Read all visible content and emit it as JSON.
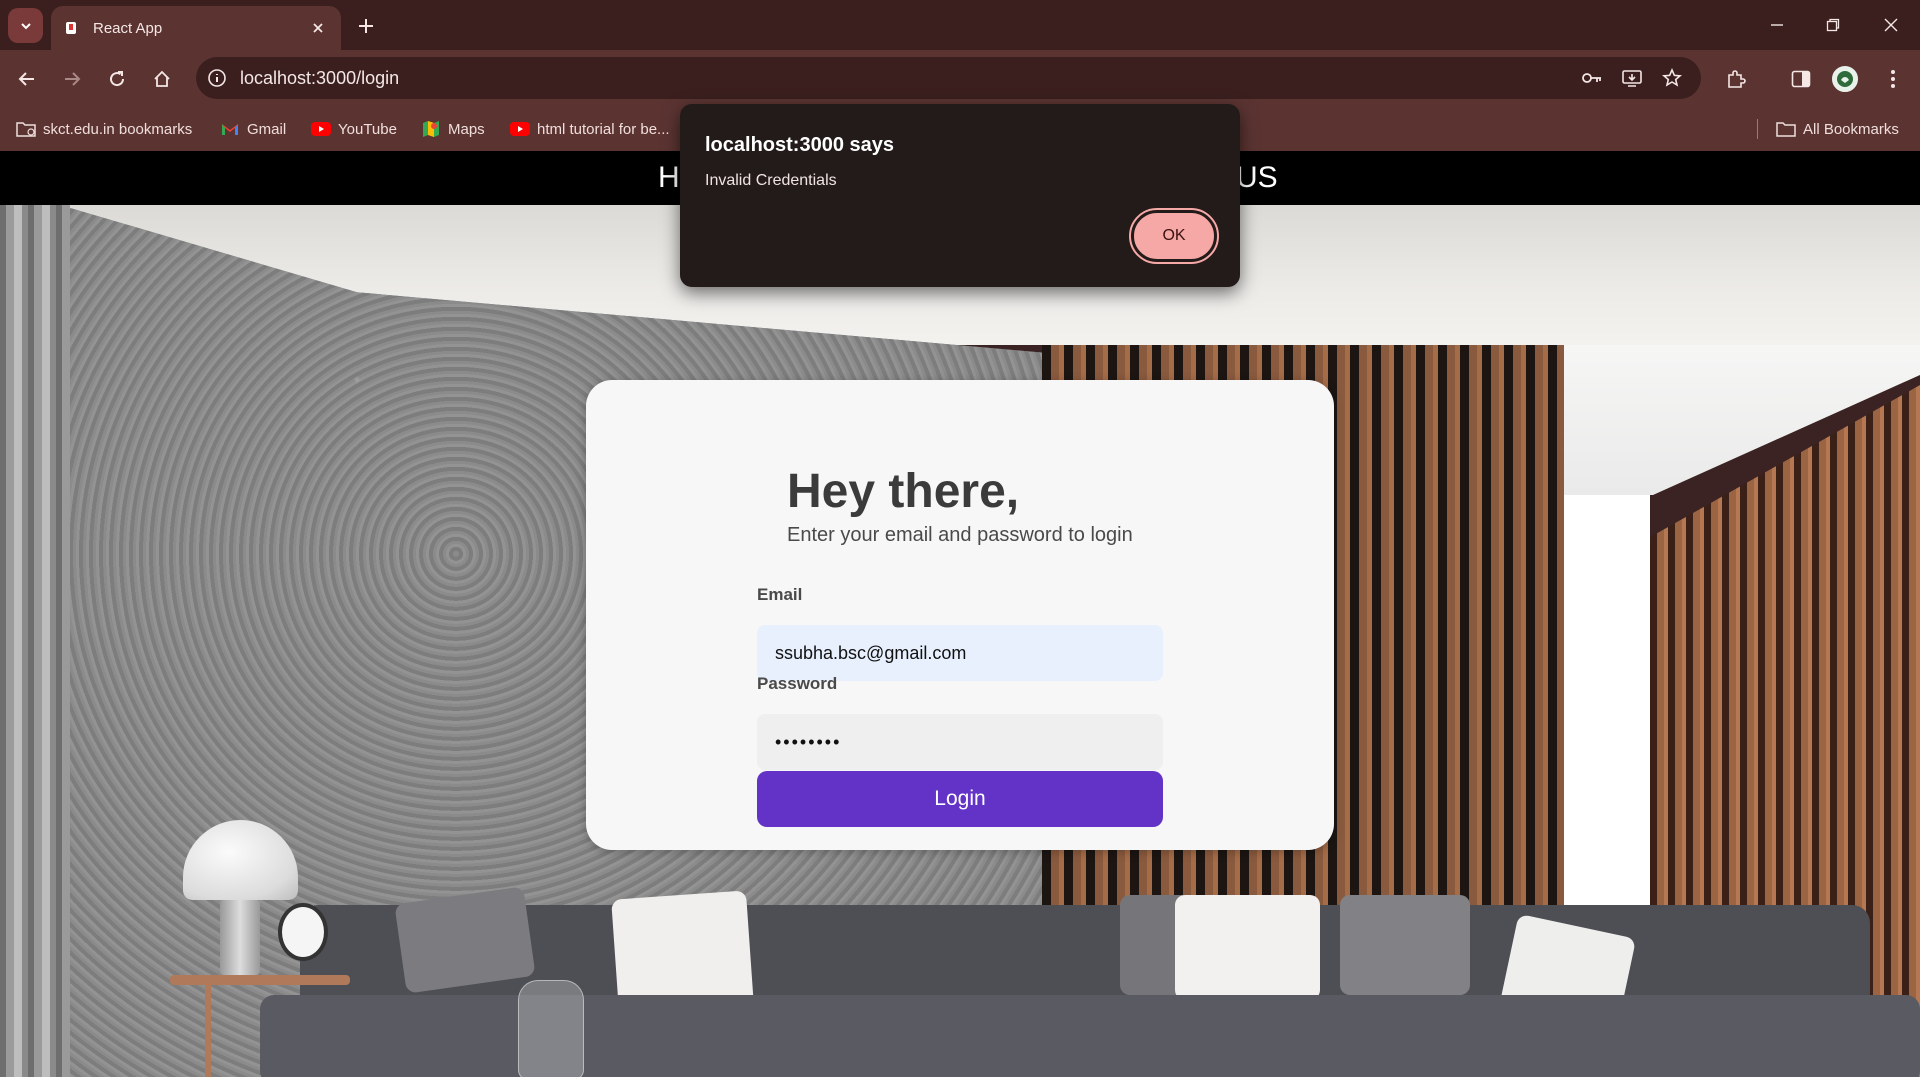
{
  "browser": {
    "tab": {
      "title": "React App"
    },
    "url": "localhost:3000/login",
    "bookmarks": [
      {
        "label": "skct.edu.in bookmarks",
        "icon": "folder-icon"
      },
      {
        "label": "Gmail",
        "icon": "gmail-icon"
      },
      {
        "label": "YouTube",
        "icon": "youtube-icon"
      },
      {
        "label": "Maps",
        "icon": "maps-icon"
      },
      {
        "label": "html tutorial for be...",
        "icon": "youtube-icon"
      }
    ],
    "all_bookmarks": "All Bookmarks",
    "colors": {
      "frame": "#3a1f1e",
      "toolbar": "#5b3432"
    }
  },
  "site": {
    "nav_left": "H",
    "nav_right": "US"
  },
  "login": {
    "title": "Hey there,",
    "subtitle": "Enter your email and password to login",
    "email_label": "Email",
    "email_value": "ssubha.bsc@gmail.com",
    "password_label": "Password",
    "password_value": "••••••••",
    "button_label": "Login",
    "colors": {
      "button": "#6233c6",
      "card": "#f7f7f8"
    }
  },
  "dialog": {
    "title": "localhost:3000 says",
    "message": "Invalid Credentials",
    "ok_label": "OK",
    "colors": {
      "ok": "#f5a8a5",
      "background": "#231a1a"
    }
  }
}
